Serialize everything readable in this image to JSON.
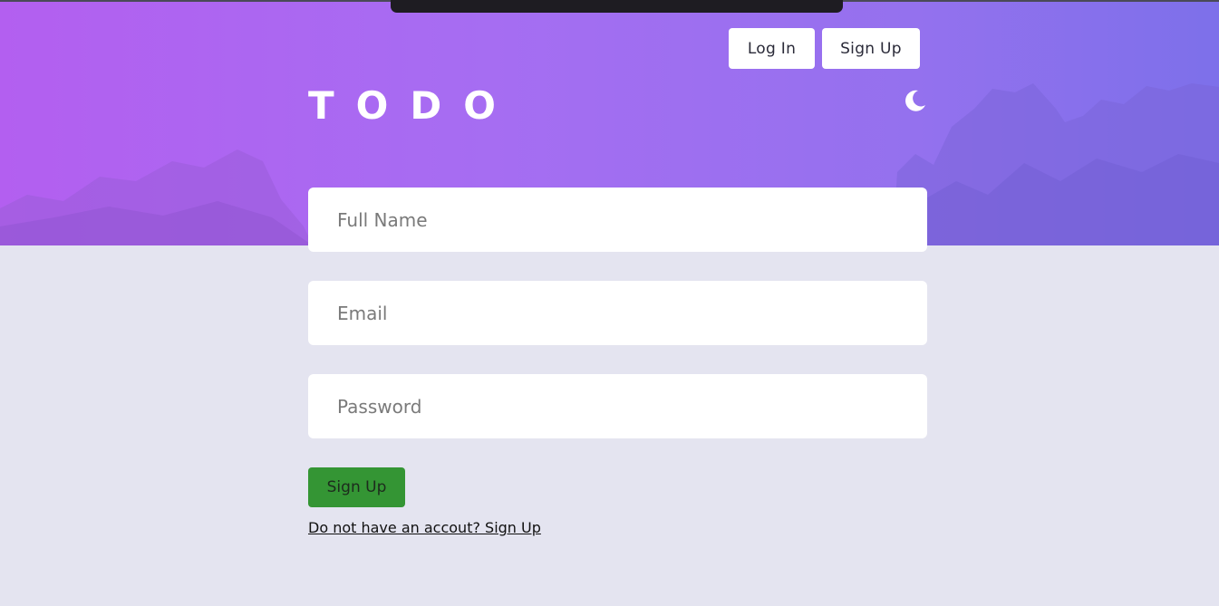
{
  "nav": {
    "login_label": "Log In",
    "signup_label": "Sign Up"
  },
  "header": {
    "brand": "TODO",
    "theme_icon": "moon-icon"
  },
  "form": {
    "full_name_placeholder": "Full Name",
    "full_name_value": "",
    "email_placeholder": "Email",
    "email_value": "",
    "password_placeholder": "Password",
    "password_value": "",
    "submit_label": "Sign Up",
    "switch_link": "Do not have an accout? Sign Up"
  },
  "colors": {
    "hero_gradient_start": "#b35ff0",
    "hero_gradient_end": "#7d70ea",
    "page_background": "#e4e4f0",
    "submit_button": "#349534",
    "field_background": "#ffffff"
  }
}
